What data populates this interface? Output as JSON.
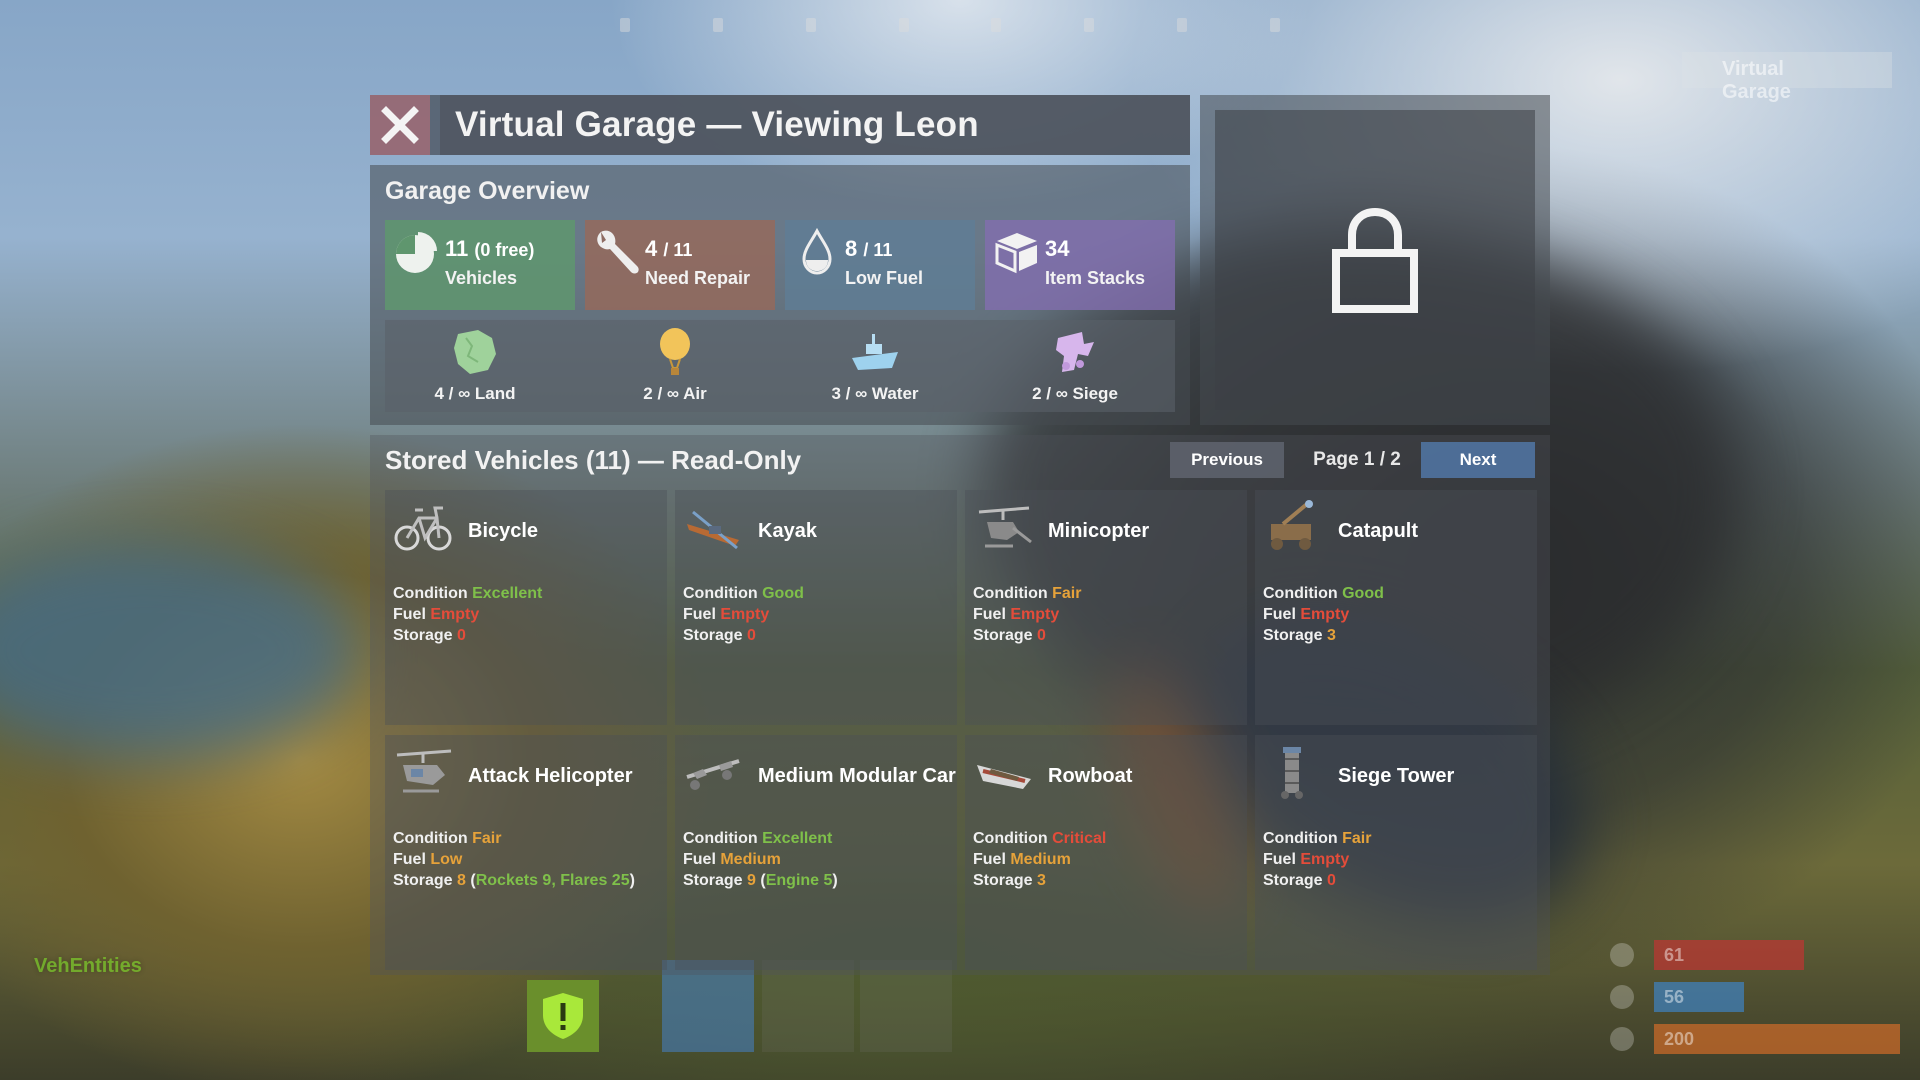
{
  "header": {
    "title": "Virtual Garage — Viewing Leon"
  },
  "overview": {
    "title": "Garage Overview",
    "stats": [
      {
        "num": "11",
        "extra": "(0 free)",
        "label": "Vehicles",
        "icon": "pie-chart-icon"
      },
      {
        "num": "4",
        "extra": "/ 11",
        "label": "Need Repair",
        "icon": "wrench-icon"
      },
      {
        "num": "8",
        "extra": "/ 11",
        "label": "Low Fuel",
        "icon": "fuel-drop-icon"
      },
      {
        "num": "34",
        "extra": "",
        "label": "Item Stacks",
        "icon": "box-icon"
      }
    ],
    "categories": [
      {
        "text": "4 / ∞ Land",
        "icon": "land-icon"
      },
      {
        "text": "2 / ∞ Air",
        "icon": "balloon-icon"
      },
      {
        "text": "3 / ∞ Water",
        "icon": "boat-icon"
      },
      {
        "text": "2 / ∞ Siege",
        "icon": "siege-icon"
      }
    ]
  },
  "list": {
    "title": "Stored Vehicles (11) — Read-Only",
    "prev_label": "Previous",
    "page_label": "Page 1 / 2",
    "next_label": "Next",
    "labels": {
      "condition": "Condition",
      "fuel": "Fuel",
      "storage": "Storage"
    },
    "vehicles": [
      {
        "name": "Bicycle",
        "condition": "Excellent",
        "fuel": "Empty",
        "storage": "0",
        "storage_detail": ""
      },
      {
        "name": "Kayak",
        "condition": "Good",
        "fuel": "Empty",
        "storage": "0",
        "storage_detail": ""
      },
      {
        "name": "Minicopter",
        "condition": "Fair",
        "fuel": "Empty",
        "storage": "0",
        "storage_detail": ""
      },
      {
        "name": "Catapult",
        "condition": "Good",
        "fuel": "Empty",
        "storage": "3",
        "storage_detail": ""
      },
      {
        "name": "Attack Helicopter",
        "condition": "Fair",
        "fuel": "Low",
        "storage": "8",
        "storage_detail": "Rockets 9, Flares 25"
      },
      {
        "name": "Medium Modular Car",
        "condition": "Excellent",
        "fuel": "Medium",
        "storage": "9",
        "storage_detail": "Engine 5"
      },
      {
        "name": "Rowboat",
        "condition": "Critical",
        "fuel": "Medium",
        "storage": "3",
        "storage_detail": ""
      },
      {
        "name": "Siege Tower",
        "condition": "Fair",
        "fuel": "Empty",
        "storage": "0",
        "storage_detail": ""
      }
    ]
  },
  "hud": {
    "garage_label": "Virtual Garage",
    "plugin_label": "VehEntities",
    "health": "61",
    "water": "56",
    "food": "200"
  },
  "colors": {
    "good": "#7fc04a",
    "warning": "#e6a23a",
    "bad": "#e44c3a",
    "next_button": "#5073a0"
  }
}
